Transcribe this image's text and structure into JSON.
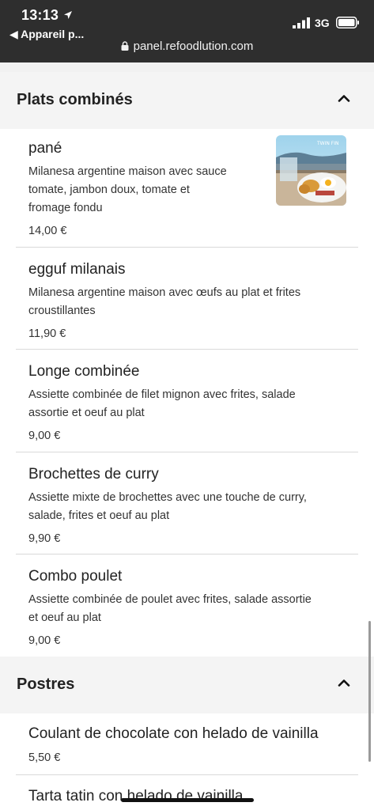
{
  "status_bar": {
    "time": "13:13",
    "back_app": "◀ Appareil p...",
    "network": "3G"
  },
  "browser": {
    "url": "panel.refoodlution.com"
  },
  "sections": [
    {
      "title": "Plats combinés",
      "items": [
        {
          "name": "pané",
          "desc_lines": [
            "Milanesa argentine maison avec sauce",
            "tomate, jambon doux, tomate et",
            "fromage fondu"
          ],
          "price": "14,00 €",
          "thumb_text": "TWIN FIN"
        },
        {
          "name": "egguf milanais",
          "desc_lines": [
            "Milanesa argentine maison avec œufs au plat et frites",
            "croustillantes"
          ],
          "price": "11,90 €"
        },
        {
          "name": "Longe combinée",
          "desc_lines": [
            "Assiette combinée de filet mignon avec frites, salade",
            "assortie et oeuf au plat"
          ],
          "price": "9,00 €"
        },
        {
          "name": "Brochettes de curry",
          "desc_lines": [
            "Assiette mixte de brochettes avec une touche de curry,",
            "salade, frites et oeuf au plat"
          ],
          "price": "9,90 €"
        },
        {
          "name": "Combo poulet",
          "desc_lines": [
            "Assiette combinée de poulet avec frites, salade assortie",
            "et oeuf au plat"
          ],
          "price": "9,00 €"
        }
      ]
    },
    {
      "title": "Postres",
      "items": [
        {
          "name": "Coulant de chocolate con helado de vainilla",
          "price": "5,50 €"
        },
        {
          "name": "Tarta tatin con helado de vainilla"
        }
      ]
    }
  ]
}
